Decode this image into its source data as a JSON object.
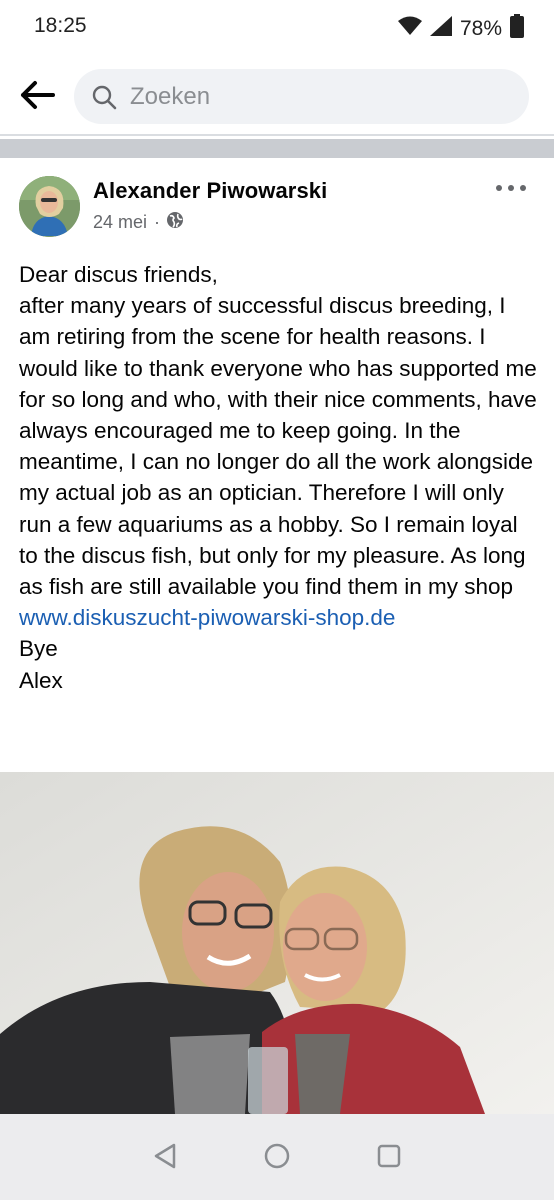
{
  "status_bar": {
    "time": "18:25",
    "battery_percent": "78%",
    "icons": [
      "wifi-icon",
      "signal-icon",
      "battery-icon"
    ]
  },
  "header": {
    "back_icon": "arrow-left-icon",
    "search_placeholder": "Zoeken",
    "search_value": ""
  },
  "post": {
    "author": "Alexander Piwowarski",
    "date": "24 mei",
    "separator": "·",
    "privacy_icon": "globe-icon",
    "more_icon": "more-horizontal-icon",
    "lines": [
      "Dear discus friends,",
      "after many years of successful discus breeding, I am retiring from the scene for health reasons. I would like to thank everyone who has supported me for so long and who, with their nice comments, have always encouraged me to keep going. In the meantime, I can no longer do all the work alongside my actual job as an optician. Therefore I will only run a few aquariums as a hobby. So I remain loyal to the discus fish, but only for my pleasure. As long as fish are still available you find them in my shop"
    ],
    "link": "www.diskuszucht-piwowarski-shop.de",
    "closing_1": "Bye",
    "closing_2": "Alex"
  },
  "nav_bar": {
    "icons": [
      "back-triangle-icon",
      "home-circle-icon",
      "recents-square-icon"
    ]
  },
  "colors": {
    "link": "#1b5fb3",
    "search_bg": "#f0f2f5",
    "separator": "#c9ccd1",
    "secondary_text": "#65676b",
    "nav_bg": "#ececee"
  }
}
